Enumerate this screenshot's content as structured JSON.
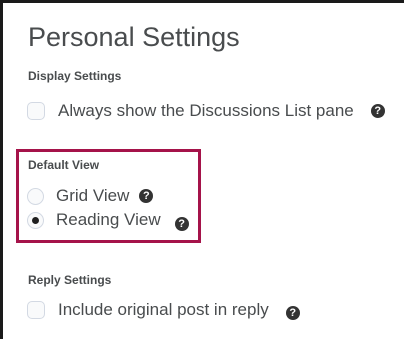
{
  "page": {
    "title": "Personal Settings"
  },
  "display_settings": {
    "heading": "Display Settings",
    "always_show_label": "Always show the Discussions List pane",
    "always_show_checked": false
  },
  "default_view": {
    "heading": "Default View",
    "options": [
      {
        "label": "Grid View",
        "selected": false
      },
      {
        "label": "Reading View",
        "selected": true
      }
    ]
  },
  "reply_settings": {
    "heading": "Reply Settings",
    "include_original_label": "Include original post in reply",
    "include_original_checked": false
  },
  "icons": {
    "help": "help-icon",
    "help_glyph": "?"
  },
  "colors": {
    "highlight": "#a5134a",
    "text": "#494c4e",
    "help_icon_bg": "#333333"
  }
}
